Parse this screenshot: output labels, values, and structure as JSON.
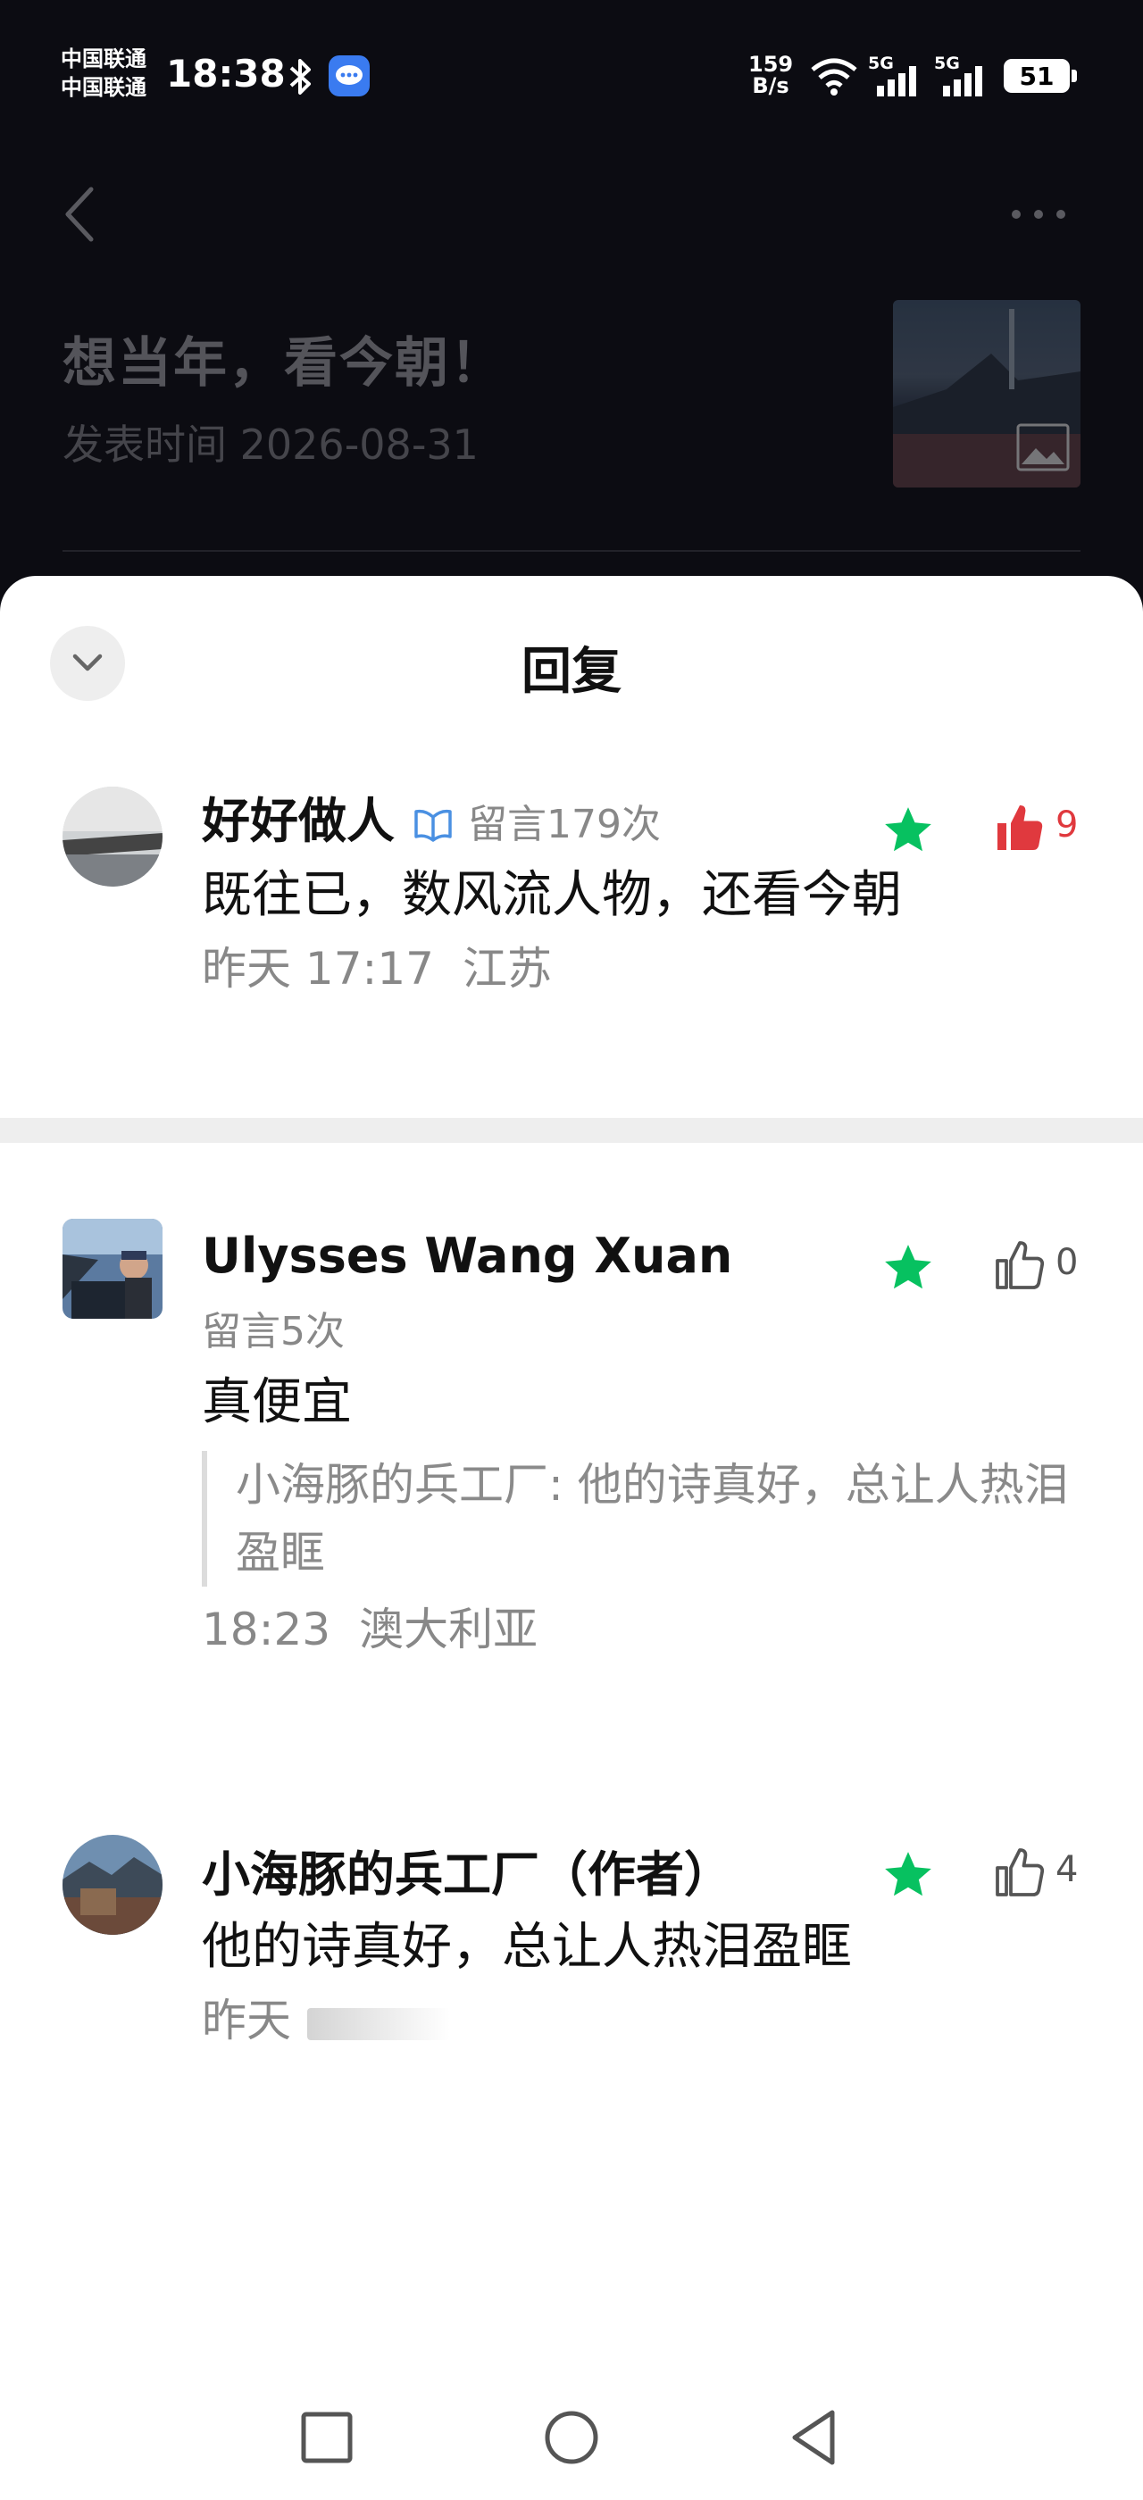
{
  "status_bar": {
    "carrier_1": "中国联通",
    "carrier_2": "中国联通",
    "time": "18:38",
    "net_speed_value": "159",
    "net_speed_unit": "B/s",
    "signal_1_label": "5G",
    "signal_2_label": "5G",
    "battery": "51",
    "icons": [
      "bluetooth-icon",
      "message-app-icon",
      "wifi-icon",
      "signal-icon",
      "battery-icon"
    ]
  },
  "article": {
    "title": "想当年，看今朝！",
    "publish_date": "发表时间 2026-08-31"
  },
  "sheet": {
    "title": "回复"
  },
  "comments": [
    {
      "name": "好好做人",
      "meta": "留言179次",
      "text": "既往已，数风流人物，还看今朝",
      "time": "昨天 17:17",
      "location": "江苏",
      "likes": "9",
      "liked": true,
      "starred": true
    },
    {
      "name": "Ulysses Wang Xuan",
      "meta": "留言5次",
      "text": "真便宜",
      "quote": "小海豚的兵工厂: 他的诗真好，总让人热泪盈眶",
      "time": "18:23",
      "location": "澳大利亚",
      "likes": "0",
      "liked": false,
      "starred": true
    },
    {
      "name": "小海豚的兵工厂（作者）",
      "text": "他的诗真好，总让人热泪盈眶",
      "time": "昨天",
      "likes": "4",
      "liked": false,
      "starred": true
    }
  ],
  "colors": {
    "star_green": "#07c160",
    "like_red": "#e0393e",
    "badge_blue": "#4a90e2"
  }
}
